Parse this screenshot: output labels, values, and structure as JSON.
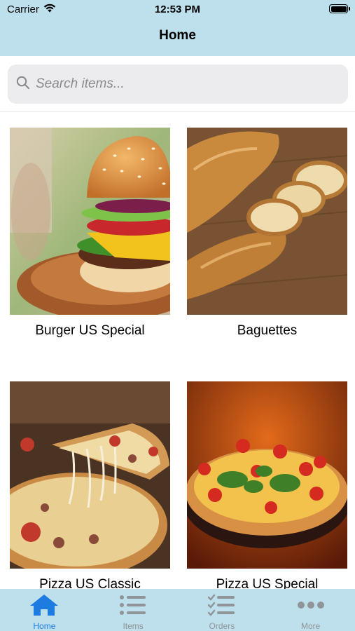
{
  "status_bar": {
    "carrier": "Carrier",
    "time": "12:53 PM"
  },
  "nav": {
    "title": "Home"
  },
  "search": {
    "placeholder": "Search items..."
  },
  "items": [
    {
      "name": "Burger US Special"
    },
    {
      "name": "Baguettes"
    },
    {
      "name": "Pizza US Classic"
    },
    {
      "name": "Pizza US Special"
    }
  ],
  "tabs": [
    {
      "label": "Home",
      "icon": "home-icon",
      "active": true
    },
    {
      "label": "Items",
      "icon": "list-icon",
      "active": false
    },
    {
      "label": "Orders",
      "icon": "checklist-icon",
      "active": false
    },
    {
      "label": "More",
      "icon": "more-icon",
      "active": false
    }
  ],
  "colors": {
    "bar": "#bde0ec",
    "accent": "#1e7be0",
    "inactive": "#8f9499"
  }
}
